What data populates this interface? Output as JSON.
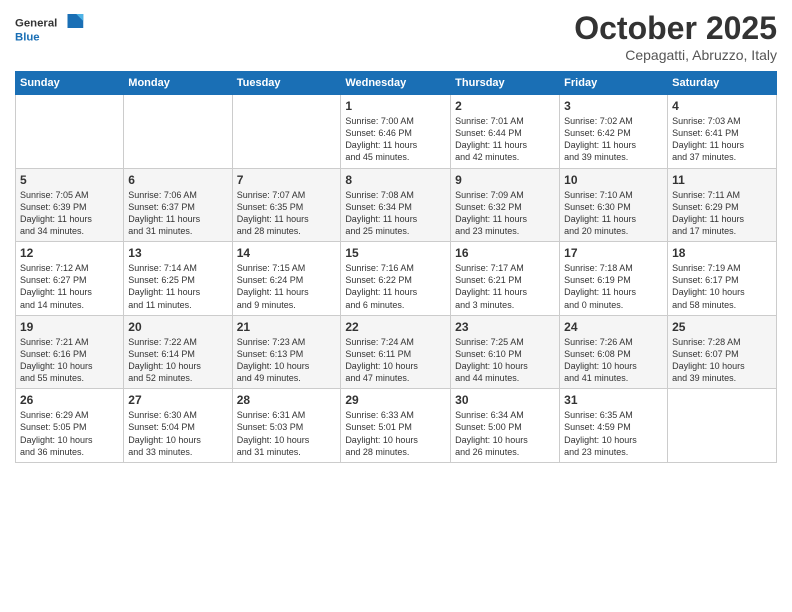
{
  "logo": {
    "general": "General",
    "blue": "Blue"
  },
  "title": "October 2025",
  "location": "Cepagatti, Abruzzo, Italy",
  "days_of_week": [
    "Sunday",
    "Monday",
    "Tuesday",
    "Wednesday",
    "Thursday",
    "Friday",
    "Saturday"
  ],
  "weeks": [
    [
      {
        "day": "",
        "info": ""
      },
      {
        "day": "",
        "info": ""
      },
      {
        "day": "",
        "info": ""
      },
      {
        "day": "1",
        "info": "Sunrise: 7:00 AM\nSunset: 6:46 PM\nDaylight: 11 hours\nand 45 minutes."
      },
      {
        "day": "2",
        "info": "Sunrise: 7:01 AM\nSunset: 6:44 PM\nDaylight: 11 hours\nand 42 minutes."
      },
      {
        "day": "3",
        "info": "Sunrise: 7:02 AM\nSunset: 6:42 PM\nDaylight: 11 hours\nand 39 minutes."
      },
      {
        "day": "4",
        "info": "Sunrise: 7:03 AM\nSunset: 6:41 PM\nDaylight: 11 hours\nand 37 minutes."
      }
    ],
    [
      {
        "day": "5",
        "info": "Sunrise: 7:05 AM\nSunset: 6:39 PM\nDaylight: 11 hours\nand 34 minutes."
      },
      {
        "day": "6",
        "info": "Sunrise: 7:06 AM\nSunset: 6:37 PM\nDaylight: 11 hours\nand 31 minutes."
      },
      {
        "day": "7",
        "info": "Sunrise: 7:07 AM\nSunset: 6:35 PM\nDaylight: 11 hours\nand 28 minutes."
      },
      {
        "day": "8",
        "info": "Sunrise: 7:08 AM\nSunset: 6:34 PM\nDaylight: 11 hours\nand 25 minutes."
      },
      {
        "day": "9",
        "info": "Sunrise: 7:09 AM\nSunset: 6:32 PM\nDaylight: 11 hours\nand 23 minutes."
      },
      {
        "day": "10",
        "info": "Sunrise: 7:10 AM\nSunset: 6:30 PM\nDaylight: 11 hours\nand 20 minutes."
      },
      {
        "day": "11",
        "info": "Sunrise: 7:11 AM\nSunset: 6:29 PM\nDaylight: 11 hours\nand 17 minutes."
      }
    ],
    [
      {
        "day": "12",
        "info": "Sunrise: 7:12 AM\nSunset: 6:27 PM\nDaylight: 11 hours\nand 14 minutes."
      },
      {
        "day": "13",
        "info": "Sunrise: 7:14 AM\nSunset: 6:25 PM\nDaylight: 11 hours\nand 11 minutes."
      },
      {
        "day": "14",
        "info": "Sunrise: 7:15 AM\nSunset: 6:24 PM\nDaylight: 11 hours\nand 9 minutes."
      },
      {
        "day": "15",
        "info": "Sunrise: 7:16 AM\nSunset: 6:22 PM\nDaylight: 11 hours\nand 6 minutes."
      },
      {
        "day": "16",
        "info": "Sunrise: 7:17 AM\nSunset: 6:21 PM\nDaylight: 11 hours\nand 3 minutes."
      },
      {
        "day": "17",
        "info": "Sunrise: 7:18 AM\nSunset: 6:19 PM\nDaylight: 11 hours\nand 0 minutes."
      },
      {
        "day": "18",
        "info": "Sunrise: 7:19 AM\nSunset: 6:17 PM\nDaylight: 10 hours\nand 58 minutes."
      }
    ],
    [
      {
        "day": "19",
        "info": "Sunrise: 7:21 AM\nSunset: 6:16 PM\nDaylight: 10 hours\nand 55 minutes."
      },
      {
        "day": "20",
        "info": "Sunrise: 7:22 AM\nSunset: 6:14 PM\nDaylight: 10 hours\nand 52 minutes."
      },
      {
        "day": "21",
        "info": "Sunrise: 7:23 AM\nSunset: 6:13 PM\nDaylight: 10 hours\nand 49 minutes."
      },
      {
        "day": "22",
        "info": "Sunrise: 7:24 AM\nSunset: 6:11 PM\nDaylight: 10 hours\nand 47 minutes."
      },
      {
        "day": "23",
        "info": "Sunrise: 7:25 AM\nSunset: 6:10 PM\nDaylight: 10 hours\nand 44 minutes."
      },
      {
        "day": "24",
        "info": "Sunrise: 7:26 AM\nSunset: 6:08 PM\nDaylight: 10 hours\nand 41 minutes."
      },
      {
        "day": "25",
        "info": "Sunrise: 7:28 AM\nSunset: 6:07 PM\nDaylight: 10 hours\nand 39 minutes."
      }
    ],
    [
      {
        "day": "26",
        "info": "Sunrise: 6:29 AM\nSunset: 5:05 PM\nDaylight: 10 hours\nand 36 minutes."
      },
      {
        "day": "27",
        "info": "Sunrise: 6:30 AM\nSunset: 5:04 PM\nDaylight: 10 hours\nand 33 minutes."
      },
      {
        "day": "28",
        "info": "Sunrise: 6:31 AM\nSunset: 5:03 PM\nDaylight: 10 hours\nand 31 minutes."
      },
      {
        "day": "29",
        "info": "Sunrise: 6:33 AM\nSunset: 5:01 PM\nDaylight: 10 hours\nand 28 minutes."
      },
      {
        "day": "30",
        "info": "Sunrise: 6:34 AM\nSunset: 5:00 PM\nDaylight: 10 hours\nand 26 minutes."
      },
      {
        "day": "31",
        "info": "Sunrise: 6:35 AM\nSunset: 4:59 PM\nDaylight: 10 hours\nand 23 minutes."
      },
      {
        "day": "",
        "info": ""
      }
    ]
  ]
}
